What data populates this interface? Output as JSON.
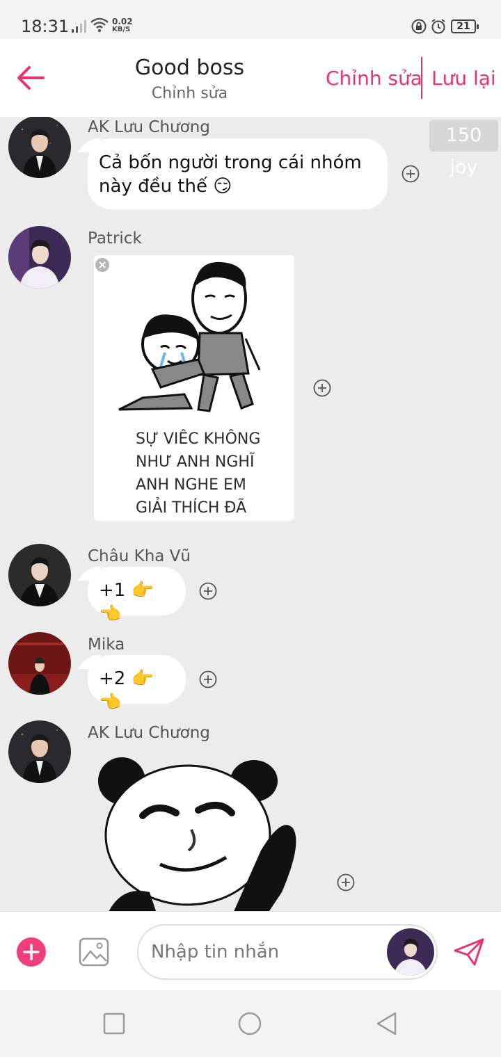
{
  "status_bar": {
    "time": "18:31",
    "net_speed_value": "0.02",
    "net_speed_unit": "KB/S",
    "battery": "21"
  },
  "header": {
    "title": "Good boss",
    "subtitle": "Chỉnh sửa",
    "edit_label": "Chỉnh sửa",
    "save_label": "Lưu lại"
  },
  "accent_color": "#e8336f",
  "joy_badge": "150 joy",
  "messages": [
    {
      "sender": "AK Lưu Chương",
      "text_line1": "Cả bốn người trong cái nhóm",
      "text_line2": "này đều thế 😏"
    },
    {
      "sender": "Patrick",
      "meme_lines": [
        "SỰ VIÊC KHÔNG",
        "NHƯ ANH NGHĨ",
        "ANH NGHE EM",
        "GIẢI THÍCH ĐÃ"
      ]
    },
    {
      "sender": "Châu Kha Vũ",
      "text": "+1 👉👈"
    },
    {
      "sender": "Mika",
      "text": "+2 👉👈"
    },
    {
      "sender": "AK Lưu Chương",
      "sticker": "panda-meme"
    }
  ],
  "composer": {
    "placeholder": "Nhập tin nhắn"
  }
}
